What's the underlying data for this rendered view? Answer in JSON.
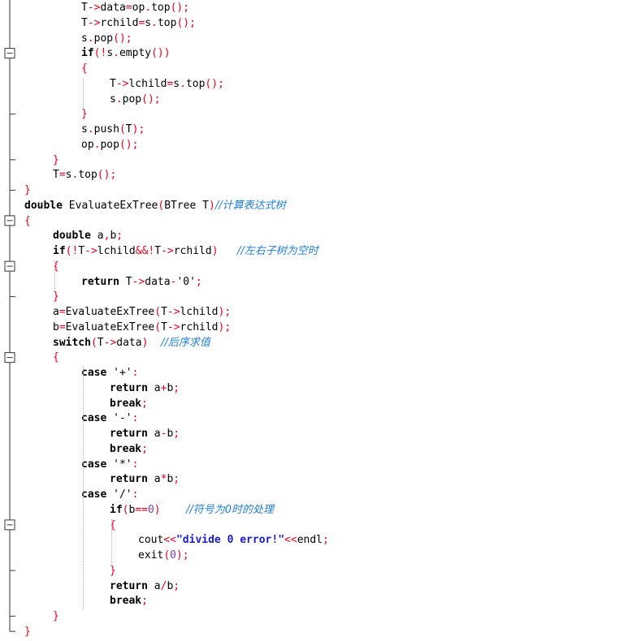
{
  "code_lines": [
    {
      "indent": 2,
      "tokens": [
        {
          "t": "T",
          "c": "plain"
        },
        {
          "t": "->",
          "c": "op"
        },
        {
          "t": "data",
          "c": "plain"
        },
        {
          "t": "=",
          "c": "op"
        },
        {
          "t": "op",
          "c": "plain"
        },
        {
          "t": ".",
          "c": "op"
        },
        {
          "t": "top",
          "c": "plain"
        },
        {
          "t": "();",
          "c": "op"
        }
      ]
    },
    {
      "indent": 2,
      "tokens": [
        {
          "t": "T",
          "c": "plain"
        },
        {
          "t": "->",
          "c": "op"
        },
        {
          "t": "rchild",
          "c": "plain"
        },
        {
          "t": "=",
          "c": "op"
        },
        {
          "t": "s",
          "c": "plain"
        },
        {
          "t": ".",
          "c": "op"
        },
        {
          "t": "top",
          "c": "plain"
        },
        {
          "t": "();",
          "c": "op"
        }
      ]
    },
    {
      "indent": 2,
      "tokens": [
        {
          "t": "s",
          "c": "plain"
        },
        {
          "t": ".",
          "c": "op"
        },
        {
          "t": "pop",
          "c": "plain"
        },
        {
          "t": "();",
          "c": "op"
        }
      ]
    },
    {
      "indent": 2,
      "tokens": [
        {
          "t": "if",
          "c": "kw"
        },
        {
          "t": "(!",
          "c": "op"
        },
        {
          "t": "s",
          "c": "plain"
        },
        {
          "t": ".",
          "c": "op"
        },
        {
          "t": "empty",
          "c": "plain"
        },
        {
          "t": "())",
          "c": "op"
        }
      ]
    },
    {
      "indent": 2,
      "tokens": [
        {
          "t": "{",
          "c": "op"
        }
      ]
    },
    {
      "indent": 3,
      "tokens": [
        {
          "t": "T",
          "c": "plain"
        },
        {
          "t": "->",
          "c": "op"
        },
        {
          "t": "lchild",
          "c": "plain"
        },
        {
          "t": "=",
          "c": "op"
        },
        {
          "t": "s",
          "c": "plain"
        },
        {
          "t": ".",
          "c": "op"
        },
        {
          "t": "top",
          "c": "plain"
        },
        {
          "t": "();",
          "c": "op"
        }
      ]
    },
    {
      "indent": 3,
      "tokens": [
        {
          "t": "s",
          "c": "plain"
        },
        {
          "t": ".",
          "c": "op"
        },
        {
          "t": "pop",
          "c": "plain"
        },
        {
          "t": "();",
          "c": "op"
        }
      ]
    },
    {
      "indent": 2,
      "tokens": [
        {
          "t": "}",
          "c": "op"
        }
      ]
    },
    {
      "indent": 2,
      "tokens": [
        {
          "t": "s",
          "c": "plain"
        },
        {
          "t": ".",
          "c": "op"
        },
        {
          "t": "push",
          "c": "plain"
        },
        {
          "t": "(",
          "c": "op"
        },
        {
          "t": "T",
          "c": "plain"
        },
        {
          "t": ");",
          "c": "op"
        }
      ]
    },
    {
      "indent": 2,
      "tokens": [
        {
          "t": "op",
          "c": "plain"
        },
        {
          "t": ".",
          "c": "op"
        },
        {
          "t": "pop",
          "c": "plain"
        },
        {
          "t": "();",
          "c": "op"
        }
      ]
    },
    {
      "indent": 1,
      "tokens": [
        {
          "t": "}",
          "c": "op"
        }
      ]
    },
    {
      "indent": 1,
      "tokens": [
        {
          "t": "T",
          "c": "plain"
        },
        {
          "t": "=",
          "c": "op"
        },
        {
          "t": "s",
          "c": "plain"
        },
        {
          "t": ".",
          "c": "op"
        },
        {
          "t": "top",
          "c": "plain"
        },
        {
          "t": "();",
          "c": "op"
        }
      ]
    },
    {
      "indent": 0,
      "tokens": [
        {
          "t": "}",
          "c": "op"
        }
      ]
    },
    {
      "indent": 0,
      "tokens": [
        {
          "t": "double",
          "c": "kw"
        },
        {
          "t": " EvaluateExTree",
          "c": "plain"
        },
        {
          "t": "(",
          "c": "op"
        },
        {
          "t": "BTree T",
          "c": "plain"
        },
        {
          "t": ")",
          "c": "op"
        },
        {
          "t": "//计算表达式树",
          "c": "cm"
        }
      ]
    },
    {
      "indent": 0,
      "tokens": [
        {
          "t": "{",
          "c": "op"
        }
      ]
    },
    {
      "indent": 1,
      "tokens": [
        {
          "t": "double",
          "c": "kw"
        },
        {
          "t": " a",
          "c": "plain"
        },
        {
          "t": ",",
          "c": "op"
        },
        {
          "t": "b",
          "c": "plain"
        },
        {
          "t": ";",
          "c": "op"
        }
      ]
    },
    {
      "indent": 1,
      "tokens": [
        {
          "t": "if",
          "c": "kw"
        },
        {
          "t": "(!",
          "c": "op"
        },
        {
          "t": "T",
          "c": "plain"
        },
        {
          "t": "->",
          "c": "op"
        },
        {
          "t": "lchild",
          "c": "plain"
        },
        {
          "t": "&&!",
          "c": "op"
        },
        {
          "t": "T",
          "c": "plain"
        },
        {
          "t": "->",
          "c": "op"
        },
        {
          "t": "rchild",
          "c": "plain"
        },
        {
          "t": ")",
          "c": "op"
        },
        {
          "t": "   ",
          "c": "plain"
        },
        {
          "t": "//左右子树为空时",
          "c": "cm"
        }
      ]
    },
    {
      "indent": 1,
      "tokens": [
        {
          "t": "{",
          "c": "op"
        }
      ]
    },
    {
      "indent": 2,
      "tokens": [
        {
          "t": "return",
          "c": "kw"
        },
        {
          "t": " T",
          "c": "plain"
        },
        {
          "t": "->",
          "c": "op"
        },
        {
          "t": "data",
          "c": "plain"
        },
        {
          "t": "-",
          "c": "op"
        },
        {
          "t": "'0'",
          "c": "plain"
        },
        {
          "t": ";",
          "c": "op"
        }
      ]
    },
    {
      "indent": 1,
      "tokens": [
        {
          "t": "}",
          "c": "op"
        }
      ]
    },
    {
      "indent": 1,
      "tokens": [
        {
          "t": "a",
          "c": "plain"
        },
        {
          "t": "=",
          "c": "op"
        },
        {
          "t": "EvaluateExTree",
          "c": "plain"
        },
        {
          "t": "(",
          "c": "op"
        },
        {
          "t": "T",
          "c": "plain"
        },
        {
          "t": "->",
          "c": "op"
        },
        {
          "t": "lchild",
          "c": "plain"
        },
        {
          "t": ");",
          "c": "op"
        }
      ]
    },
    {
      "indent": 1,
      "tokens": [
        {
          "t": "b",
          "c": "plain"
        },
        {
          "t": "=",
          "c": "op"
        },
        {
          "t": "EvaluateExTree",
          "c": "plain"
        },
        {
          "t": "(",
          "c": "op"
        },
        {
          "t": "T",
          "c": "plain"
        },
        {
          "t": "->",
          "c": "op"
        },
        {
          "t": "rchild",
          "c": "plain"
        },
        {
          "t": ");",
          "c": "op"
        }
      ]
    },
    {
      "indent": 1,
      "tokens": [
        {
          "t": "switch",
          "c": "kw"
        },
        {
          "t": "(",
          "c": "op"
        },
        {
          "t": "T",
          "c": "plain"
        },
        {
          "t": "->",
          "c": "op"
        },
        {
          "t": "data",
          "c": "plain"
        },
        {
          "t": ")",
          "c": "op"
        },
        {
          "t": "  ",
          "c": "plain"
        },
        {
          "t": "//后序求值",
          "c": "cm"
        }
      ]
    },
    {
      "indent": 1,
      "tokens": [
        {
          "t": "{",
          "c": "op"
        }
      ]
    },
    {
      "indent": 2,
      "tokens": [
        {
          "t": "case",
          "c": "kw"
        },
        {
          "t": " '+'",
          "c": "plain"
        },
        {
          "t": ":",
          "c": "op"
        }
      ]
    },
    {
      "indent": 3,
      "tokens": [
        {
          "t": "return",
          "c": "kw"
        },
        {
          "t": " a",
          "c": "plain"
        },
        {
          "t": "+",
          "c": "op"
        },
        {
          "t": "b",
          "c": "plain"
        },
        {
          "t": ";",
          "c": "op"
        }
      ]
    },
    {
      "indent": 3,
      "tokens": [
        {
          "t": "break",
          "c": "kw"
        },
        {
          "t": ";",
          "c": "op"
        }
      ]
    },
    {
      "indent": 2,
      "tokens": [
        {
          "t": "case",
          "c": "kw"
        },
        {
          "t": " '-'",
          "c": "plain"
        },
        {
          "t": ":",
          "c": "op"
        }
      ]
    },
    {
      "indent": 3,
      "tokens": [
        {
          "t": "return",
          "c": "kw"
        },
        {
          "t": " a",
          "c": "plain"
        },
        {
          "t": "-",
          "c": "op"
        },
        {
          "t": "b",
          "c": "plain"
        },
        {
          "t": ";",
          "c": "op"
        }
      ]
    },
    {
      "indent": 3,
      "tokens": [
        {
          "t": "break",
          "c": "kw"
        },
        {
          "t": ";",
          "c": "op"
        }
      ]
    },
    {
      "indent": 2,
      "tokens": [
        {
          "t": "case",
          "c": "kw"
        },
        {
          "t": " '*'",
          "c": "plain"
        },
        {
          "t": ":",
          "c": "op"
        }
      ]
    },
    {
      "indent": 3,
      "tokens": [
        {
          "t": "return",
          "c": "kw"
        },
        {
          "t": " a",
          "c": "plain"
        },
        {
          "t": "*",
          "c": "op"
        },
        {
          "t": "b",
          "c": "plain"
        },
        {
          "t": ";",
          "c": "op"
        }
      ]
    },
    {
      "indent": 2,
      "tokens": [
        {
          "t": "case",
          "c": "kw"
        },
        {
          "t": " '/'",
          "c": "plain"
        },
        {
          "t": ":",
          "c": "op"
        }
      ]
    },
    {
      "indent": 3,
      "tokens": [
        {
          "t": "if",
          "c": "kw"
        },
        {
          "t": "(",
          "c": "op"
        },
        {
          "t": "b",
          "c": "plain"
        },
        {
          "t": "==",
          "c": "op"
        },
        {
          "t": "0",
          "c": "num"
        },
        {
          "t": ")",
          "c": "op"
        },
        {
          "t": "    ",
          "c": "plain"
        },
        {
          "t": "//符号为0时的处理",
          "c": "cm"
        }
      ]
    },
    {
      "indent": 3,
      "tokens": [
        {
          "t": "{",
          "c": "op"
        }
      ]
    },
    {
      "indent": 4,
      "tokens": [
        {
          "t": "cout",
          "c": "plain"
        },
        {
          "t": "<<",
          "c": "op"
        },
        {
          "t": "\"divide 0 error!\"",
          "c": "str"
        },
        {
          "t": "<<",
          "c": "op"
        },
        {
          "t": "endl",
          "c": "plain"
        },
        {
          "t": ";",
          "c": "op"
        }
      ]
    },
    {
      "indent": 4,
      "tokens": [
        {
          "t": "exit",
          "c": "plain"
        },
        {
          "t": "(",
          "c": "op"
        },
        {
          "t": "0",
          "c": "num"
        },
        {
          "t": ");",
          "c": "op"
        }
      ]
    },
    {
      "indent": 3,
      "tokens": [
        {
          "t": "}",
          "c": "op"
        }
      ]
    },
    {
      "indent": 3,
      "tokens": [
        {
          "t": "return",
          "c": "kw"
        },
        {
          "t": " a",
          "c": "plain"
        },
        {
          "t": "/",
          "c": "op"
        },
        {
          "t": "b",
          "c": "plain"
        },
        {
          "t": ";",
          "c": "op"
        }
      ]
    },
    {
      "indent": 3,
      "tokens": [
        {
          "t": "break",
          "c": "kw"
        },
        {
          "t": ";",
          "c": "op"
        }
      ]
    },
    {
      "indent": 1,
      "tokens": [
        {
          "t": "}",
          "c": "op"
        }
      ]
    },
    {
      "indent": 0,
      "tokens": [
        {
          "t": "}",
          "c": "op"
        }
      ]
    }
  ],
  "fold_markers": [
    {
      "line": 3,
      "kind": "collapse"
    },
    {
      "line": 7,
      "kind": "end"
    },
    {
      "line": 10,
      "kind": "end"
    },
    {
      "line": 12,
      "kind": "end-final"
    },
    {
      "line": 14,
      "kind": "collapse"
    },
    {
      "line": 17,
      "kind": "collapse"
    },
    {
      "line": 19,
      "kind": "end"
    },
    {
      "line": 23,
      "kind": "collapse"
    },
    {
      "line": 34,
      "kind": "collapse"
    },
    {
      "line": 37,
      "kind": "end"
    },
    {
      "line": 40,
      "kind": "end"
    },
    {
      "line": 41,
      "kind": "end-final"
    }
  ],
  "colors": {
    "keyword": "#000000",
    "operator": "#e8001b",
    "number": "#7b3fb0",
    "string": "#1a1ad6",
    "comment": "#1f7fd8",
    "fold_line": "#333333"
  }
}
